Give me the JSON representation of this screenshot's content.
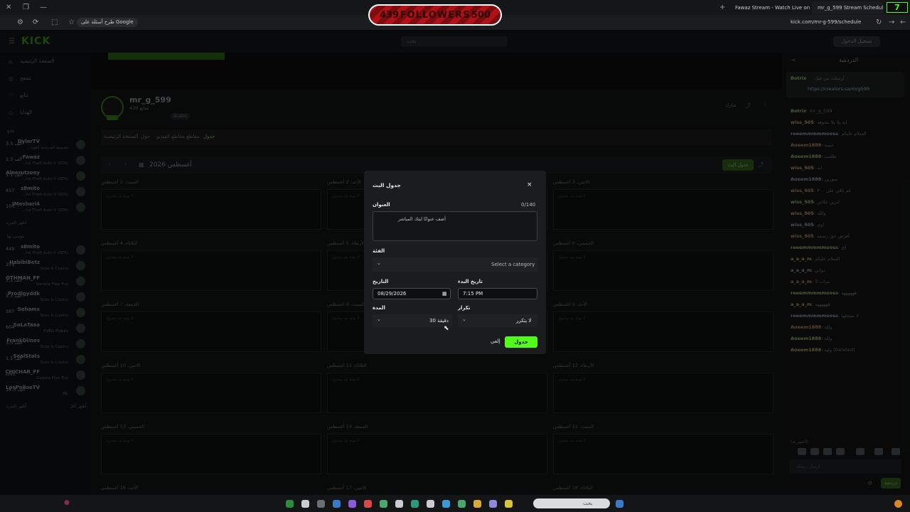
{
  "browser": {
    "tabs": [
      {
        "title": "Fawaz Stream - Watch Live on Kick",
        "active": false
      },
      {
        "title": "mr_g_599 Stream Schedule - Kick",
        "active": true
      }
    ],
    "new_tab": "+",
    "google_search": "طرح أسئلة على Google",
    "url": "kick.com/mr-g-599/schedule",
    "overlay": {
      "left": "439",
      "label": "FOLLOWERS",
      "right": "500"
    },
    "counter": "7"
  },
  "kick_header": {
    "logo": "KICK",
    "search_placeholder": "بحث",
    "login": "تسجيل الدخول"
  },
  "left_nav": {
    "items": [
      "الصفحة الرئيسية",
      "تصفح",
      "تتابع",
      "الهدايا"
    ],
    "following_title": "تتابع",
    "following": [
      {
        "name": "DylerTV",
        "game": "...مصممة المرشدة القوة",
        "count": "3.5 ألف"
      },
      {
        "name": "Fawaz",
        "game": "...nd Theft Auto V (GTA)",
        "count": "2.3 ألف"
      },
      {
        "name": "Alnerutzony",
        "game": "...nd Theft Auto V (GTA)",
        "count": "1.1 ألف"
      },
      {
        "name": "s8mito",
        "game": "...nd Theft Auto V (GTA)",
        "count": "457"
      },
      {
        "name": "IMeshari4",
        "game": "...nd Theft Auto V (GTA)",
        "count": "100"
      }
    ],
    "show_more": "أظهر المزيد",
    "recommended_title": "موصى بها",
    "recommended": [
      {
        "name": "s8mito",
        "game": "...nd Theft Auto V (GTA)",
        "count": "449"
      },
      {
        "name": "HabibiBetz",
        "game": "Slots & Casino",
        "count": "379"
      },
      {
        "name": "OTHMAN_FF",
        "game": "Garena Free Fire",
        "count": "1.1 ألف"
      },
      {
        "name": "Prodigyddk",
        "game": "Slots & Casino",
        "count": "1.3 ألف"
      },
      {
        "name": "Sehamx",
        "game": "Slots & Casino",
        "count": "387"
      },
      {
        "name": "SoLaTaaa",
        "game": "PUBG Mobile",
        "count": "604"
      },
      {
        "name": "FrankDiines",
        "game": "Slots & Casino",
        "count": "3.5 ألف"
      },
      {
        "name": "SealStats",
        "game": "Slots & Casino",
        "count": "1.1 ألف"
      },
      {
        "name": "CHICHAR_FF",
        "game": "Garena Free Fire",
        "count": "LIVE"
      },
      {
        "name": "LosPolloeTV",
        "game": "IRL",
        "count": "14.3 ألف"
      }
    ],
    "show_less": "أظهر أقل"
  },
  "profile": {
    "name": "mr_g_599",
    "followers": "439 متابع",
    "tag": "Arabic",
    "share": "شارك",
    "tabs": [
      "الصفحة الرئيسية",
      "حول",
      "مقاطع الفيديو",
      "مقاطع",
      "جدول"
    ],
    "month": "أغسطس 2026",
    "schedule_button": "جدول البث"
  },
  "calendar": {
    "empty_text": "لا توجد بث مجدول",
    "cells": [
      "السبت، 1 أغسطس",
      "الأحد، 2 أغسطس",
      "الاثنين، 3 أغسطس",
      "الثلاثاء، 4 أغسطس",
      "الأربعاء، 5 أغسطس",
      "الخميس، 6 أغسطس",
      "الجمعة، 7 أغسطس",
      "السبت، 8 أغسطس",
      "الأحد، 9 أغسطس",
      "الاثنين، 10 أغسطس",
      "الثلاثاء، 11 أغسطس",
      "الأربعاء، 12 أغسطس",
      "الخميس، 13 أغسطس",
      "الجمعة، 14 أغسطس",
      "السبت، 15 أغسطس",
      "الأحد، 16 أغسطس",
      "الاثنين، 17 أغسطس",
      "الثلاثاء، 18 أغسطس"
    ]
  },
  "modal": {
    "title": "جدول البث",
    "close": "×",
    "title_label": "العنوان",
    "title_counter": "0/140",
    "title_placeholder": "أضف عنوانًا لبثك المباشر",
    "category_label": "الفئة",
    "category_placeholder": "Select a category",
    "date_label": "التاريخ",
    "date_value": "08/29/2026",
    "start_label": "تاريخ البدء",
    "start_value": "7:15 PM",
    "duration_label": "المدة",
    "duration_value": "30 دقيقة",
    "repeat_label": "تكرار",
    "repeat_value": "لا يتكرر",
    "submit": "جدول",
    "cancel": "إلغي"
  },
  "chat": {
    "title": "الدردشة",
    "pinned_user": "Botrix",
    "pinned_text": "أرسلت من قبل",
    "pinned_link": "https://creators.sa/mrg599",
    "messages": [
      {
        "user": "Botrix",
        "text": ": mr_g_599"
      },
      {
        "user": "wiss_505",
        "text": ": ايه يلا يلا نشوفه"
      },
      {
        "user": "reeemmmmmooss",
        "text": ": السلام عليكم"
      },
      {
        "user": "Aoeem1888",
        "text": ": حبيبه"
      },
      {
        "user": "Aoeem1888",
        "text": ": طلعت"
      },
      {
        "user": "wiss_505",
        "text": ": ايه"
      },
      {
        "user": "Aoeem1888",
        "text": ": منورين"
      },
      {
        "user": "wiss_505",
        "text": ": كم باقي على ٣٠٠"
      },
      {
        "user": "wiss_505",
        "text": ": انزين خلاص"
      },
      {
        "user": "wiss_505",
        "text": ": والله"
      },
      {
        "user": "wiss_505",
        "text": ": اوي"
      },
      {
        "user": "wiss_505",
        "text": ": أفرض حق رسمه"
      },
      {
        "user": "reeemmmmmooss",
        "text": ": اي"
      },
      {
        "user": "a_a_a_m",
        "text": ": السلام عليكم"
      },
      {
        "user": "a_a_a_m",
        "text": ": دواني"
      },
      {
        "user": "a_a_a_m",
        "text": ": 3 مرات"
      },
      {
        "user": "reeemmmmmooss",
        "text": ": ههههههه"
      },
      {
        "user": "a_a_a_m",
        "text": ": ههههههه"
      },
      {
        "user": "reeemmmmmooss",
        "text": ": لا تسجلها"
      },
      {
        "user": "Aoeem1888",
        "text": ": ولله"
      },
      {
        "user": "Aoeem1888",
        "text": ": ولله"
      },
      {
        "user": "Aoeem1888",
        "text": ": وليه (Deleted)"
      }
    ],
    "emotes_label": "الأشهر هنا",
    "input_placeholder": "أرسل رسالة",
    "send": "دردشة"
  },
  "taskbar": {
    "search": "بحث"
  },
  "colors": {
    "kick_green": "#53fc18",
    "modal_bg": "#1a1c1d",
    "page_bg": "#0b0c0d"
  }
}
